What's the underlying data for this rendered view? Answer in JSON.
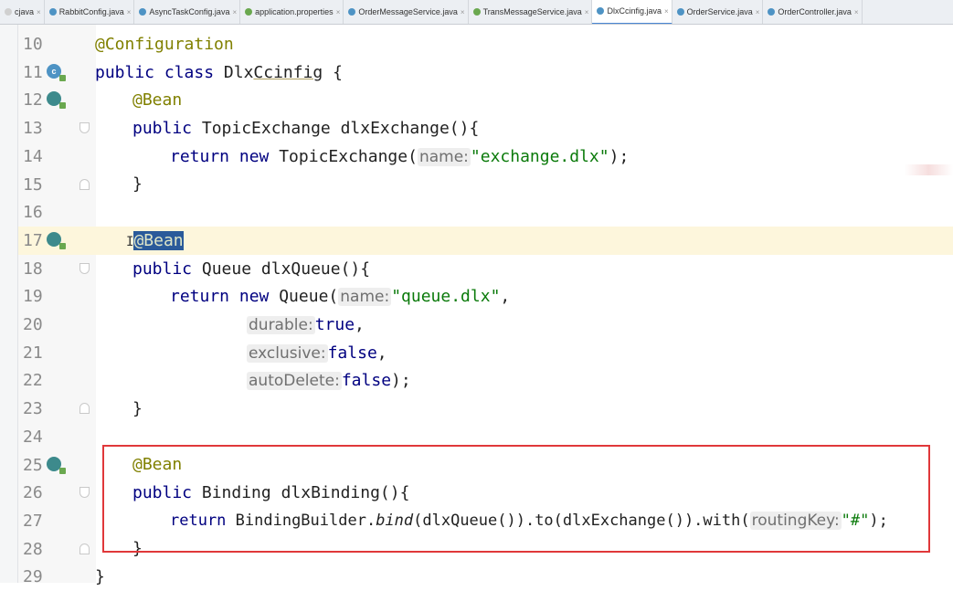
{
  "tabs": [
    {
      "label": "cjava",
      "icon_color": "#d0d0d0",
      "active": false
    },
    {
      "label": "RabbitConfig.java",
      "icon_color": "#4e93c4",
      "active": false
    },
    {
      "label": "AsyncTaskConfig.java",
      "icon_color": "#4e93c4",
      "active": false
    },
    {
      "label": "application.properties",
      "icon_color": "#6aa84f",
      "active": false
    },
    {
      "label": "OrderMessageService.java",
      "icon_color": "#4e93c4",
      "active": false
    },
    {
      "label": "TransMessageService.java",
      "icon_color": "#6aa84f",
      "active": false
    },
    {
      "label": "DlxCcinfig.java",
      "icon_color": "#4e93c4",
      "active": true
    },
    {
      "label": "OrderService.java",
      "icon_color": "#4e93c4",
      "active": false
    },
    {
      "label": "OrderController.java",
      "icon_color": "#4e93c4",
      "active": false
    }
  ],
  "tab_close_glyph": "×",
  "gutter": {
    "line_numbers": [
      "10",
      "11",
      "12",
      "13",
      "14",
      "15",
      "16",
      "17",
      "18",
      "19",
      "20",
      "21",
      "22",
      "23",
      "24",
      "25",
      "26",
      "27",
      "28",
      "29"
    ],
    "class_icon_letter": "c"
  },
  "code": {
    "l10": {
      "annotation": "@Configuration"
    },
    "l11": {
      "kw": "public class ",
      "name": "Dlx",
      "name_ul": "Ccinfig",
      "rest": " {"
    },
    "l12": {
      "annotation": "@Bean"
    },
    "l13": {
      "kw": "public ",
      "type": "TopicExchange ",
      "method": "dlxExchange(){"
    },
    "l14": {
      "kw": "return new ",
      "ctor": "TopicExchange(",
      "hint": "name:",
      "str": "\"exchange.dlx\"",
      "end": ");"
    },
    "l15": {
      "text": "}"
    },
    "l17": {
      "caret": "I",
      "annotation": "@Bean"
    },
    "l18": {
      "kw": "public ",
      "type": "Queue ",
      "method": "dlxQueue(){"
    },
    "l19": {
      "kw": "return new ",
      "ctor": "Queue(",
      "hint": "name:",
      "str": "\"queue.dlx\"",
      "end": ","
    },
    "l20": {
      "hint": "durable:",
      "value": "true",
      "end": ","
    },
    "l21": {
      "hint": "exclusive:",
      "value": "false",
      "end": ","
    },
    "l22": {
      "hint": "autoDelete:",
      "value": "false",
      "end": ");"
    },
    "l23": {
      "text": "}"
    },
    "l25": {
      "annotation": "@Bean"
    },
    "l26": {
      "kw": "public ",
      "type": "Binding ",
      "method": "dlxBinding(){"
    },
    "l27": {
      "kw": "return ",
      "pre": "BindingBuilder.",
      "italic": "bind",
      "mid": "(dlxQueue()).to(dlxExchange()).with(",
      "hint": "routingKey:",
      "str": "\"#\"",
      "end": ");"
    },
    "l28": {
      "text": "}"
    },
    "l29": {
      "text": "}"
    }
  },
  "colors": {
    "keyword": "#000080",
    "annotation": "#808000",
    "string": "#0a7a0a",
    "highlight_box": "#e0383a",
    "current_line": "#fdf6dc"
  }
}
